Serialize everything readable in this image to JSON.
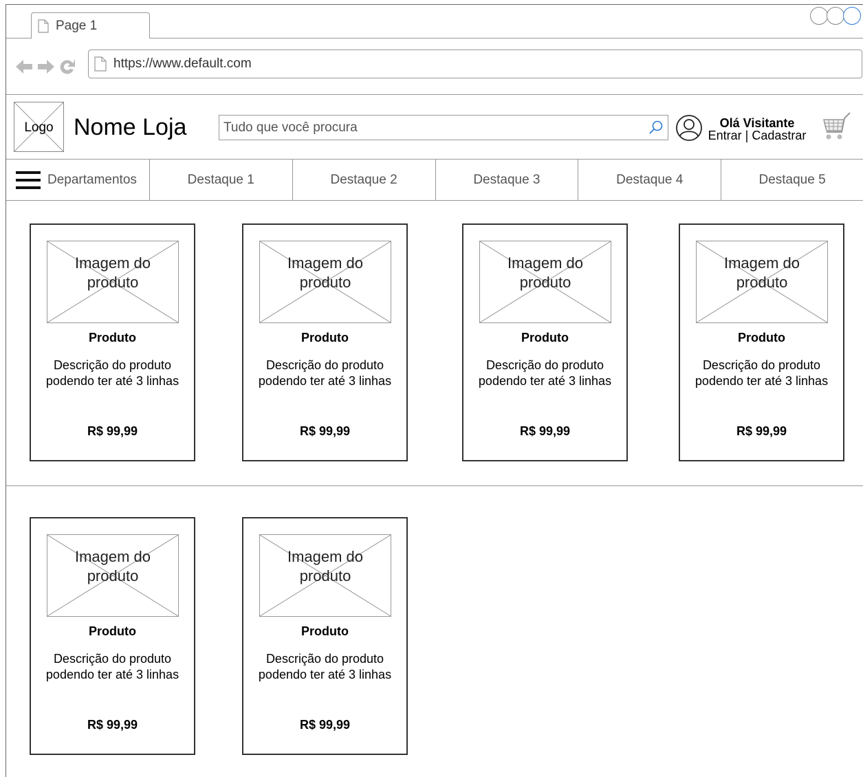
{
  "browser": {
    "tab_label": "Page 1",
    "url": "https://www.default.com"
  },
  "store": {
    "logo_label": "Logo",
    "name": "Nome Loja",
    "search_placeholder": "Tudo que você procura",
    "greeting": "Olá Visitante",
    "account_links": "Entrar | Cadastrar"
  },
  "menu": {
    "departments_label": "Departamentos",
    "items": [
      "Destaque 1",
      "Destaque 2",
      "Destaque 3",
      "Destaque 4",
      "Destaque 5"
    ]
  },
  "products": [
    {
      "image_label": "Imagem do produto",
      "name": "Produto",
      "description": "Descrição do produto podendo ter até 3 linhas",
      "price": "R$ 99,99"
    },
    {
      "image_label": "Imagem do produto",
      "name": "Produto",
      "description": "Descrição do produto podendo ter até 3 linhas",
      "price": "R$ 99,99"
    },
    {
      "image_label": "Imagem do produto",
      "name": "Produto",
      "description": "Descrição do produto podendo ter até 3 linhas",
      "price": "R$ 99,99"
    },
    {
      "image_label": "Imagem do produto",
      "name": "Produto",
      "description": "Descrição do produto podendo ter até 3 linhas",
      "price": "R$ 99,99"
    },
    {
      "image_label": "Imagem do produto",
      "name": "Produto",
      "description": "Descrição do produto podendo ter até 3 linhas",
      "price": "R$ 99,99"
    },
    {
      "image_label": "Imagem do produto",
      "name": "Produto",
      "description": "Descrição do produto podendo ter até 3 linhas",
      "price": "R$ 99,99"
    }
  ],
  "colors": {
    "accent": "#2b7bd6",
    "border": "#999999",
    "card_border": "#333333"
  },
  "icons": [
    "page-icon",
    "back-arrow-icon",
    "forward-arrow-icon",
    "reload-icon",
    "search-icon",
    "user-icon",
    "cart-icon",
    "hamburger-icon",
    "image-placeholder-icon"
  ]
}
